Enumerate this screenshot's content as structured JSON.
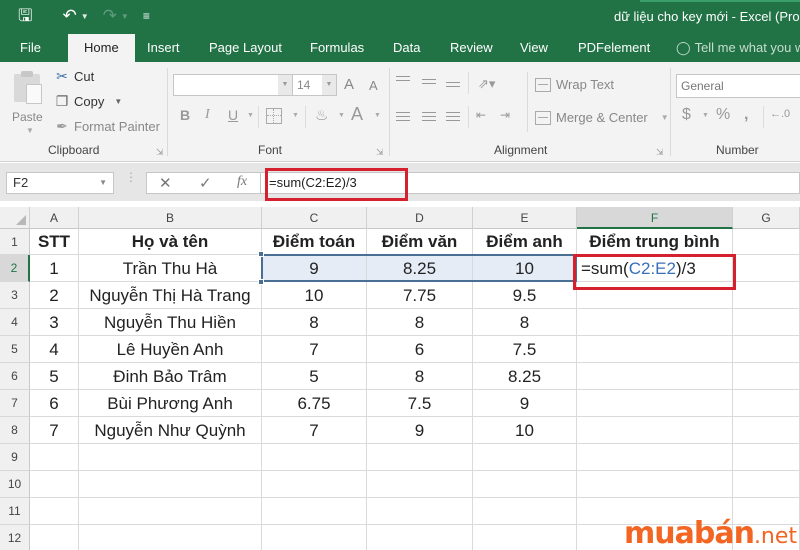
{
  "window": {
    "title": "dữ liệu cho key mới - Excel (Prod",
    "quick_access": [
      {
        "name": "save-icon",
        "glyph": "🖫"
      },
      {
        "name": "undo-icon",
        "glyph": "↶"
      },
      {
        "name": "redo-icon",
        "glyph": "↷"
      },
      {
        "name": "customize-qat-icon",
        "glyph": "≡"
      }
    ]
  },
  "tabs": [
    {
      "label": "File"
    },
    {
      "label": "Home",
      "active": true
    },
    {
      "label": "Insert"
    },
    {
      "label": "Page Layout"
    },
    {
      "label": "Formulas"
    },
    {
      "label": "Data"
    },
    {
      "label": "Review"
    },
    {
      "label": "View"
    },
    {
      "label": "PDFelement"
    }
  ],
  "tell_me": {
    "icon": "lightbulb-icon",
    "text": "Tell me what you w"
  },
  "ribbon": {
    "clipboard": {
      "label": "Clipboard",
      "paste": "Paste",
      "cut": "Cut",
      "copy": "Copy",
      "format_painter": "Format Painter"
    },
    "font": {
      "label": "Font",
      "font_name": "",
      "font_size": "14",
      "bold": "B",
      "italic": "I",
      "underline": "U",
      "grow": "A",
      "shrink": "A",
      "font_color": "A"
    },
    "alignment": {
      "label": "Alignment",
      "wrap_text": "Wrap Text",
      "merge_center": "Merge & Center"
    },
    "number": {
      "label": "Number",
      "format": "General",
      "currency": "$",
      "percent": "%",
      "comma": ","
    }
  },
  "formula_bar": {
    "name_box": "F2",
    "cancel": "✕",
    "enter": "✓",
    "fx": "fx",
    "formula": "=sum(C2:E2)/3"
  },
  "sheet": {
    "columns": [
      "A",
      "B",
      "C",
      "D",
      "E",
      "F",
      "G"
    ],
    "rows": [
      "1",
      "2",
      "3",
      "4",
      "5",
      "6",
      "7",
      "8",
      "9",
      "10",
      "11",
      "12"
    ],
    "headers": [
      "STT",
      "Họ và tên",
      "Điểm toán",
      "Điểm văn",
      "Điểm anh",
      "Điểm trung bình"
    ],
    "data": [
      [
        "1",
        "Trần Thu Hà",
        "9",
        "8.25",
        "10"
      ],
      [
        "2",
        "Nguyễn Thị Hà Trang",
        "10",
        "7.75",
        "9.5"
      ],
      [
        "3",
        "Nguyễn Thu Hiền",
        "8",
        "8",
        "8"
      ],
      [
        "4",
        "Lê Huyền Anh",
        "7",
        "6",
        "7.5"
      ],
      [
        "5",
        "Đinh Bảo Trâm",
        "5",
        "8",
        "8.25"
      ],
      [
        "6",
        "Bùi Phương Anh",
        "6.75",
        "7.5",
        "9"
      ],
      [
        "7",
        "Nguyễn Như Quỳnh",
        "7",
        "9",
        "10"
      ]
    ],
    "active_cell": "F2",
    "active_formula": {
      "prefix": "=sum(",
      "ref": "C2:E2",
      "suffix": ")/3"
    },
    "ref_color": "#3b6fb8",
    "highlight_color": "#d4202f"
  },
  "watermark": {
    "brand": "muabán",
    "tld": ".net",
    "color": "#f26522"
  }
}
